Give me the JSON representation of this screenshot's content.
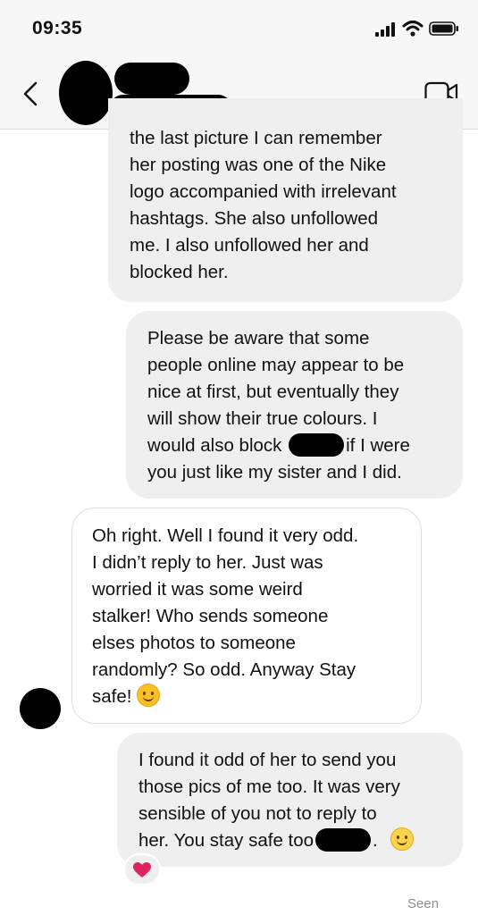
{
  "status_bar": {
    "time": "09:35"
  },
  "header": {
    "contact_name": ""
  },
  "messages": [
    {
      "direction": "outgoing",
      "lines": [
        "the last picture I can remember",
        "her posting was one of the Nike",
        "logo accompanied with irrelevant",
        "hashtags. She also unfollowed",
        "me. I also unfollowed her and",
        "blocked her."
      ]
    },
    {
      "direction": "outgoing",
      "lines": [
        "Please be aware that some",
        "people online may appear to be",
        "nice at first, but eventually they",
        "will show their true colours. I"
      ],
      "line5_before": "would also block",
      "line5_after": "if I were",
      "line6": "you just like my sister and I did."
    },
    {
      "direction": "incoming",
      "lines": [
        "Oh right. Well I found it very odd.",
        "I didn’t reply to her. Just was",
        "worried it was some weird",
        "stalker!  Who sends someone",
        "elses photos to someone",
        "randomly? So odd. Anyway Stay"
      ],
      "last_line": "safe!",
      "emoji": "smiling-face-with-smiling-eyes"
    },
    {
      "direction": "outgoing",
      "lines": [
        "I found it odd of her to send you",
        "those pics of me too. It was very",
        "sensible of you not to reply to"
      ],
      "last_before": "her. You stay safe too",
      "last_after": ".",
      "emoji": "slightly-smiling-face",
      "reaction": "heart"
    }
  ],
  "footer": {
    "seen": "Seen"
  },
  "colors": {
    "outgoing_bubble": "#efeff0",
    "incoming_border": "#dedede",
    "reaction_heart": "#e0245e"
  }
}
